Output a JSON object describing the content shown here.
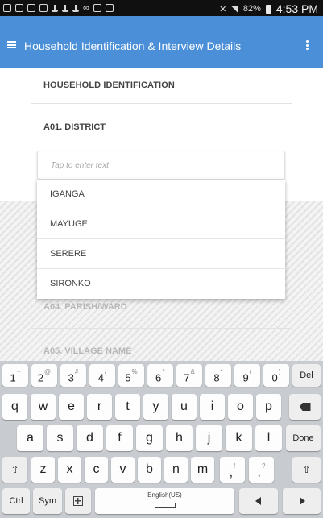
{
  "status_bar": {
    "time": "4:53 PM",
    "battery_percent": "82%",
    "left_icons": [
      "notification-icon",
      "notification-icon",
      "image-icon",
      "mail-icon",
      "download-icon",
      "download-icon",
      "download-icon",
      "voicemail-icon",
      "android-icon",
      "android-icon"
    ],
    "right_icons": [
      "mute-icon",
      "wifi-icon",
      "battery-icon"
    ]
  },
  "app_bar": {
    "title": "Household Identification & Interview Details",
    "menu_icon": "hamburger-menu-icon",
    "overflow_icon": "more-vert-icon",
    "color": "#4b8fd8"
  },
  "form": {
    "section_title": "HOUSEHOLD IDENTIFICATION",
    "question_label": "A01. DISTRICT",
    "input_placeholder": "Tap to enter text",
    "dropdown_options": [
      "IGANGA",
      "MAYUGE",
      "SERERE",
      "SIRONKO"
    ],
    "hidden_questions": [
      "A04. PARISH/WARD",
      "A05. VILLAGE NAME"
    ]
  },
  "keyboard": {
    "number_row": [
      {
        "k": "1",
        "s": "~"
      },
      {
        "k": "2",
        "s": "@"
      },
      {
        "k": "3",
        "s": "#"
      },
      {
        "k": "4",
        "s": "/"
      },
      {
        "k": "5",
        "s": "%"
      },
      {
        "k": "6",
        "s": "^"
      },
      {
        "k": "7",
        "s": "&"
      },
      {
        "k": "8",
        "s": "*"
      },
      {
        "k": "9",
        "s": "("
      },
      {
        "k": "0",
        "s": ")"
      }
    ],
    "del_label": "Del",
    "row1": [
      "q",
      "w",
      "e",
      "r",
      "t",
      "y",
      "u",
      "i",
      "o",
      "p"
    ],
    "row2": [
      "a",
      "s",
      "d",
      "f",
      "g",
      "h",
      "j",
      "k",
      "l"
    ],
    "done_label": "Done",
    "row3": [
      "z",
      "x",
      "c",
      "v",
      "b",
      "n",
      "m"
    ],
    "comma_label": ",",
    "comma_sup": "!",
    "period_label": ".",
    "period_sup": "?",
    "ctrl_label": "Ctrl",
    "sym_label": "Sym",
    "space_label": "English(US)",
    "shift_glyph": "⇧"
  }
}
